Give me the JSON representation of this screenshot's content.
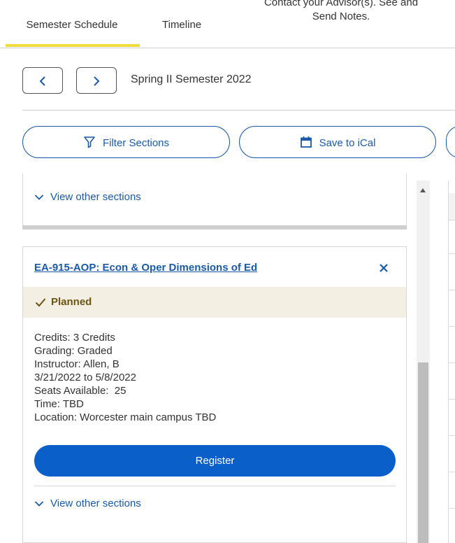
{
  "tabs": {
    "schedule": "Semester Schedule",
    "timeline": "Timeline",
    "contact_line1": "Contact your Advisor(s). See and",
    "contact_line2": "Send Notes."
  },
  "term": {
    "title": "Spring II Semester 2022"
  },
  "actions": {
    "filter_label": "Filter Sections",
    "ical_label": "Save to iCal"
  },
  "previous_card": {
    "view_other": "View other sections"
  },
  "course": {
    "title": "EA-915-AOP: Econ & Oper Dimensions of Ed",
    "status": "Planned",
    "credits": "Credits: 3 Credits",
    "grading": "Grading: Graded",
    "instructor": "Instructor: Allen, B",
    "dates": "3/21/2022 to 5/8/2022",
    "seats": "Seats Available:  25",
    "time": "Time: TBD",
    "location": "Location: Worcester main campus TBD",
    "register_label": "Register",
    "view_other": "View other sections"
  },
  "colors": {
    "accent": "#1a5aa6",
    "button": "#0b5fc9",
    "tab_underline": "#f2dc3c",
    "planned_bg": "#f3efe3",
    "planned_text": "#6b5512"
  },
  "icons": {
    "prev": "chevron-left-icon",
    "next": "chevron-right-icon",
    "filter": "filter-icon",
    "calendar": "calendar-icon",
    "check": "check-icon",
    "close": "close-icon",
    "expand": "chevron-down-icon"
  }
}
